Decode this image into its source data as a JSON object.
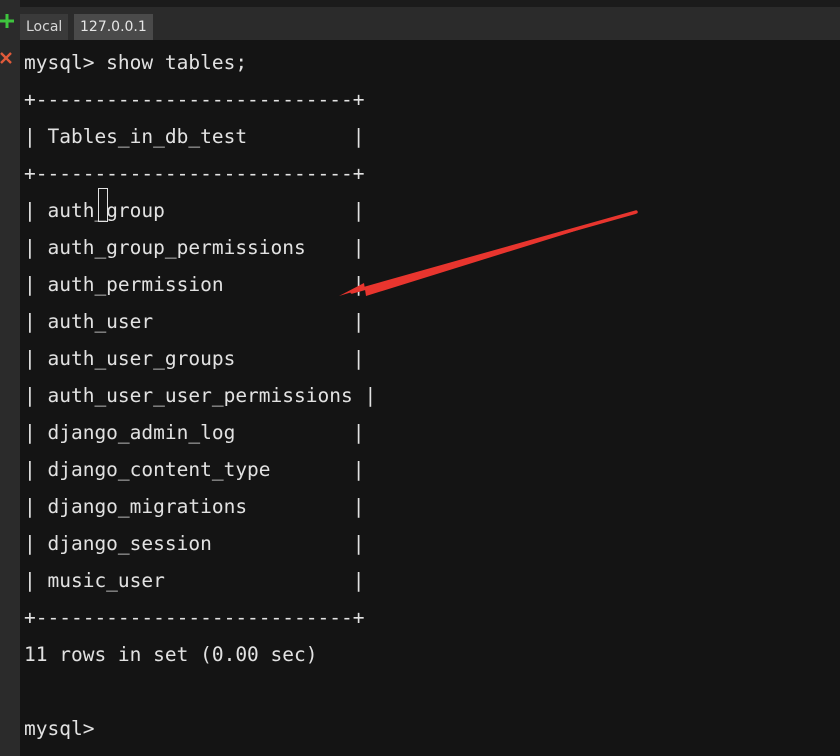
{
  "tabs": [
    {
      "label": "Local"
    },
    {
      "label": "127.0.0.1"
    }
  ],
  "terminal": {
    "prompt_command": "mysql> show tables;",
    "border_top": "+---------------------------+",
    "header_row": "| Tables_in_db_test         |",
    "border_mid": "+---------------------------+",
    "rows": [
      "| auth_group                |",
      "| auth_group_permissions    |",
      "| auth_permission           |",
      "| auth_user                 |",
      "| auth_user_groups          |",
      "| auth_user_user_permissions |",
      "| django_admin_log          |",
      "| django_content_type       |",
      "| django_migrations         |",
      "| django_session            |",
      "| music_user                |"
    ],
    "border_bottom": "+---------------------------+",
    "result_summary": "11 rows in set (0.00 sec)",
    "prompt_final": "mysql>"
  },
  "colors": {
    "background": "#141414",
    "text": "#e2e2e2",
    "add_icon": "#3ec43e",
    "close_icon": "#e05a3a",
    "arrow": "#e8352e"
  },
  "icons": [
    "plus-icon",
    "close-icon"
  ]
}
